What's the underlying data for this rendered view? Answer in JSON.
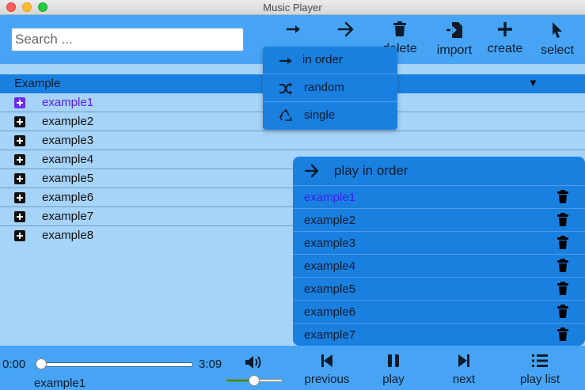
{
  "window": {
    "title": "Music Player"
  },
  "toolbar": {
    "search_placeholder": "Search ...",
    "buttons": [
      {
        "icon": "long-arrow-right-icon",
        "label": ""
      },
      {
        "icon": "arrow-right-icon",
        "label": ""
      },
      {
        "icon": "trash-icon",
        "label": "delete"
      },
      {
        "icon": "import-icon",
        "label": "import"
      },
      {
        "icon": "plus-icon",
        "label": "create"
      },
      {
        "icon": "cursor-icon",
        "label": "select"
      }
    ]
  },
  "play_mode_menu": {
    "items": [
      {
        "icon": "long-arrow-right-icon",
        "label": "in order"
      },
      {
        "icon": "shuffle-icon",
        "label": "random"
      },
      {
        "icon": "recycle-icon",
        "label": "single"
      }
    ]
  },
  "library": {
    "header": "Example",
    "header_icon": "triangle-down-icon",
    "items": [
      "example1",
      "example2",
      "example3",
      "example4",
      "example5",
      "example6",
      "example7",
      "example8"
    ],
    "active_index": 0
  },
  "playlist": {
    "title": "play in order",
    "items": [
      "example1",
      "example2",
      "example3",
      "example4",
      "example5",
      "example6",
      "example7"
    ],
    "active_index": 0
  },
  "player": {
    "current_time": "0:00",
    "total_time": "3:09",
    "progress": 0,
    "now_playing": "example1",
    "volume": 0.5,
    "controls": [
      {
        "icon": "previous-icon",
        "label": "previous"
      },
      {
        "icon": "pause-icon",
        "label": "play"
      },
      {
        "icon": "next-icon",
        "label": "next"
      },
      {
        "icon": "list-icon",
        "label": "play list"
      }
    ]
  },
  "colors": {
    "toolbar_bg": "#47a4f5",
    "content_bg": "#a6d3f8",
    "accent_bg": "#1a80e0",
    "active_text": "#5a1bf0",
    "volume_fill": "#1a9a1a"
  }
}
